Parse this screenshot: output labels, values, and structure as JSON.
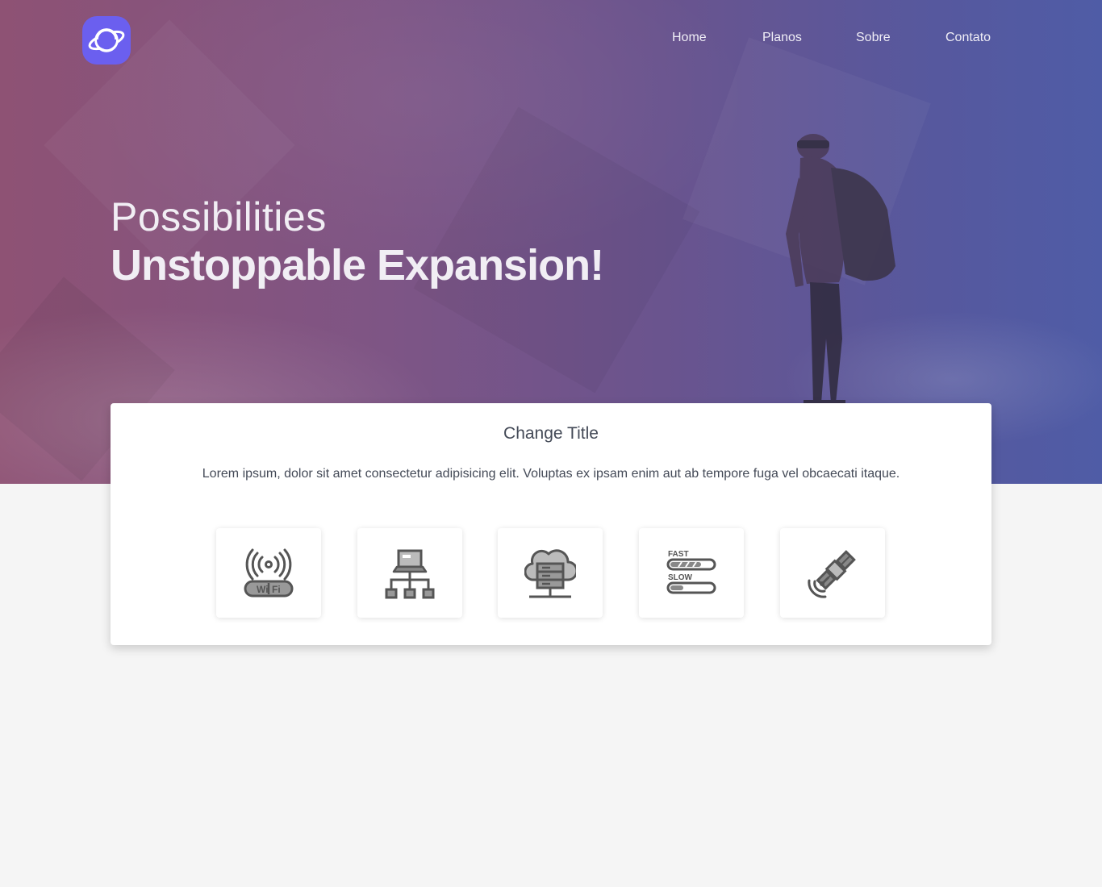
{
  "brand": {
    "logo_icon": "planet-icon",
    "accent": "#6b5fef"
  },
  "nav": {
    "items": [
      {
        "label": "Home"
      },
      {
        "label": "Planos"
      },
      {
        "label": "Sobre"
      },
      {
        "label": "Contato"
      }
    ]
  },
  "hero": {
    "subtitle": "Possibilities",
    "title": "Unstoppable Expansion!",
    "gradient": [
      "#8e5274",
      "#4f5ca6"
    ]
  },
  "card": {
    "title": "Change Title",
    "text": "Lorem ipsum, dolor sit amet consectetur adipisicing elit. Voluptas ex ipsam enim aut ab tempore fuga vel obcaecati itaque."
  },
  "features": [
    {
      "icon": "wifi-router-icon",
      "text_wifi": "Wi",
      "text_fi": "Fi"
    },
    {
      "icon": "network-icon"
    },
    {
      "icon": "cloud-server-icon"
    },
    {
      "icon": "speed-icon",
      "text_fast": "FAST",
      "text_slow": "SLOW"
    },
    {
      "icon": "satellite-icon"
    }
  ]
}
